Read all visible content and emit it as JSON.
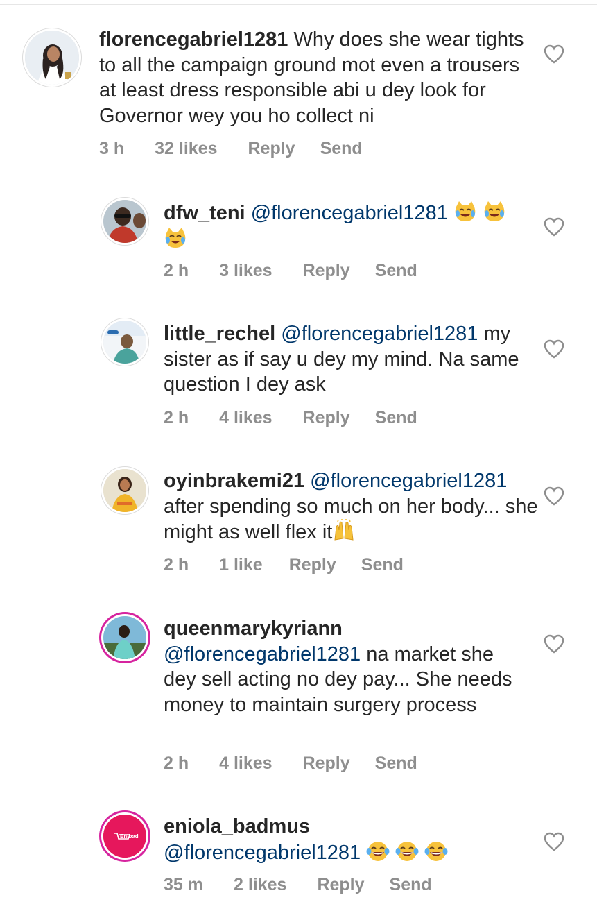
{
  "comments": [
    {
      "username": "florencegabriel1281",
      "mention": "",
      "text": "Why does she wear tights to all the campaign ground mot even a trousers  at least dress responsible abi u dey look for Governor wey you ho collect ni",
      "time": "3 h",
      "likes": "32 likes",
      "reply": "Reply",
      "send": "Send"
    },
    {
      "username": "dfw_teni",
      "mention": "@florencegabriel1281",
      "text": "",
      "time": "2 h",
      "likes": "3 likes",
      "reply": "Reply",
      "send": "Send",
      "emoji": "crying-cat-emoji"
    },
    {
      "username": "little_rechel",
      "mention": "@florencegabriel1281",
      "text": "my sister as if say u dey my mind. Na same question I dey ask",
      "time": "2 h",
      "likes": "4 likes",
      "reply": "Reply",
      "send": "Send"
    },
    {
      "username": "oyinbrakemi21",
      "mention": "@florencegabriel1281",
      "text": "after spending so much on her body... she might as well flex it",
      "time": "2 h",
      "likes": "1 like",
      "reply": "Reply",
      "send": "Send",
      "emoji": "raised-hands-emoji"
    },
    {
      "username": "queenmarykyriann",
      "mention": "@florencegabriel1281",
      "text": "na market she dey sell acting no dey pay... She needs money to maintain surgery process",
      "time": "2 h",
      "likes": "4 likes",
      "reply": "Reply",
      "send": "Send"
    },
    {
      "username": "eniola_badmus",
      "mention": "@florencegabriel1281",
      "text": "",
      "time": "35 m",
      "likes": "2 likes",
      "reply": "Reply",
      "send": "Send",
      "emoji": "laughing-tears-emoji",
      "avatar_logo_text": "Enibad"
    }
  ],
  "colors": {
    "text": "#262626",
    "meta": "#8e8e8e",
    "mention": "#00376b",
    "story_ring": "#d6249f"
  }
}
